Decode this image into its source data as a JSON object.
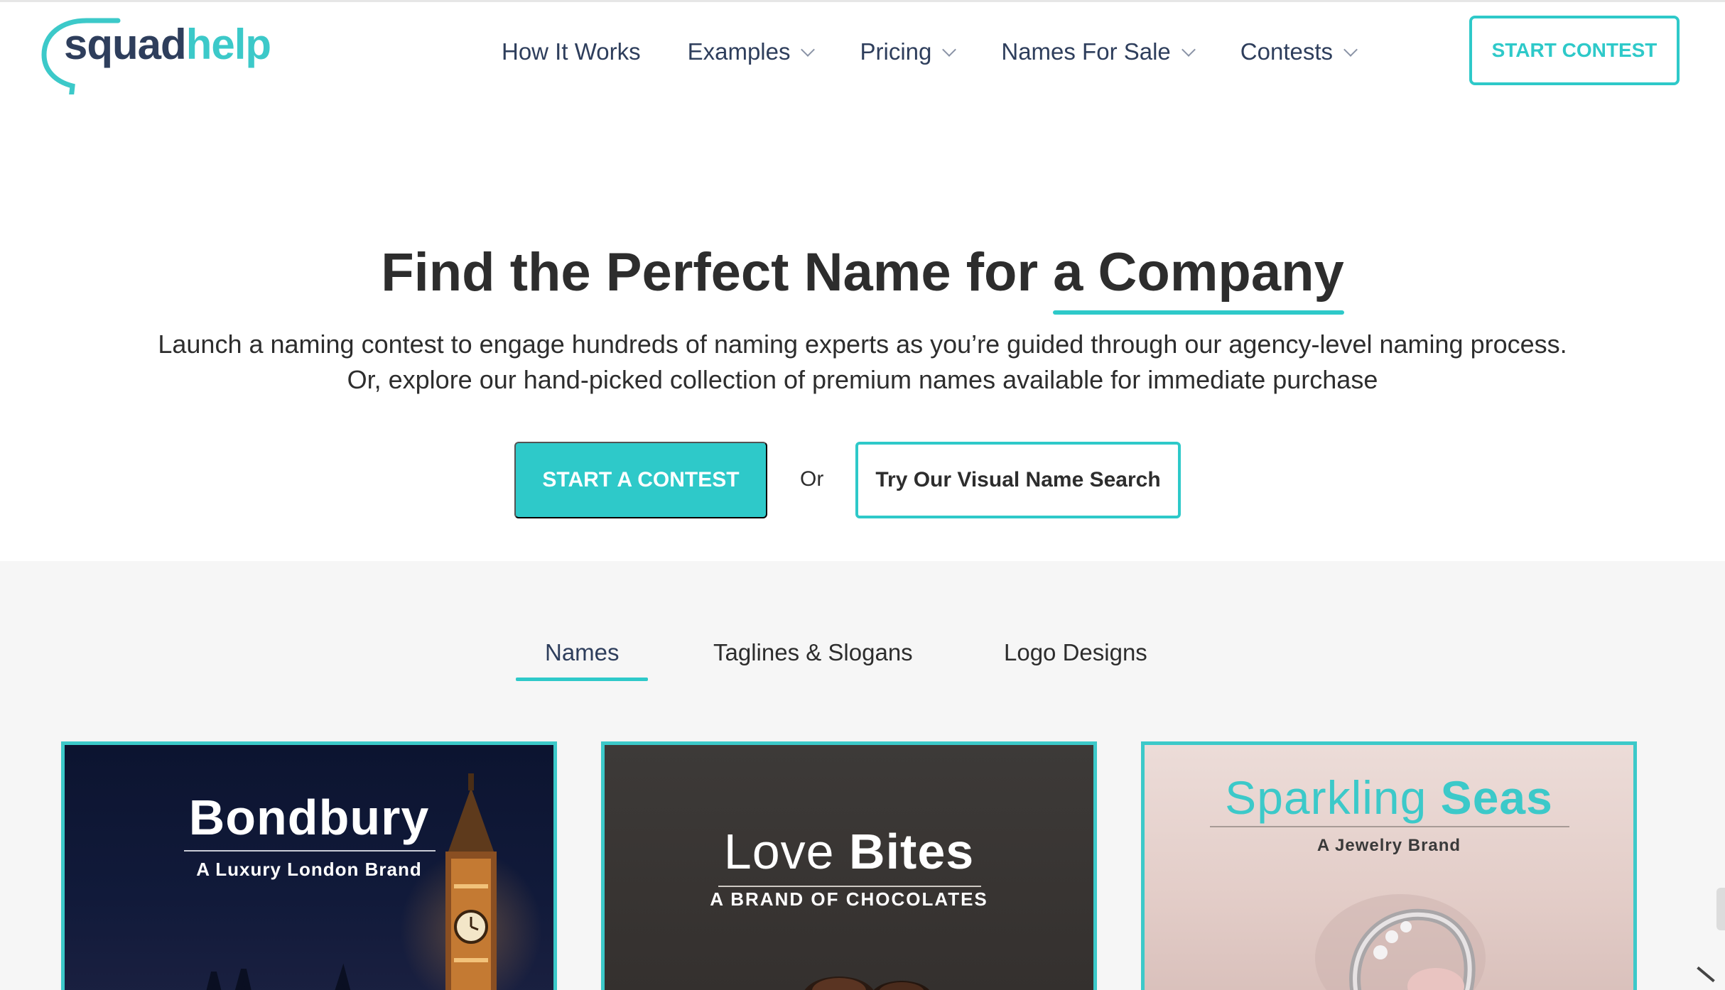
{
  "brand": {
    "logo_part1": "squad",
    "logo_part2": "help",
    "primary_color": "#2ec9c9",
    "navy_color": "#2e3e5c"
  },
  "nav": {
    "items": [
      {
        "label": "How It Works",
        "has_dropdown": false
      },
      {
        "label": "Examples",
        "has_dropdown": true
      },
      {
        "label": "Pricing",
        "has_dropdown": true
      },
      {
        "label": "Names For Sale",
        "has_dropdown": true
      },
      {
        "label": "Contests",
        "has_dropdown": true
      }
    ],
    "cta_label": "START CONTEST"
  },
  "hero": {
    "title_prefix": "Find the Perfect Name for",
    "title_emphasis": "a Company",
    "subtitle_line1": "Launch a naming contest to engage hundreds of naming experts as you’re guided through our agency-level naming process.",
    "subtitle_line2": "Or, explore our hand-picked collection of premium names available for immediate purchase",
    "primary_button": "START A CONTEST",
    "or_text": "Or",
    "secondary_button": "Try Our Visual Name Search"
  },
  "examples": {
    "tabs": [
      "Names",
      "Taglines & Slogans",
      "Logo Designs"
    ],
    "active_tab": "Names",
    "cards": [
      {
        "title": "Bondbury",
        "subtitle": "A Luxury London Brand"
      },
      {
        "title_light": "Love",
        "title_bold": "Bites",
        "subtitle": "A BRAND OF CHOCOLATES"
      },
      {
        "title_light": "Sparkling",
        "title_bold": "Seas",
        "subtitle": "A Jewelry Brand"
      }
    ]
  }
}
